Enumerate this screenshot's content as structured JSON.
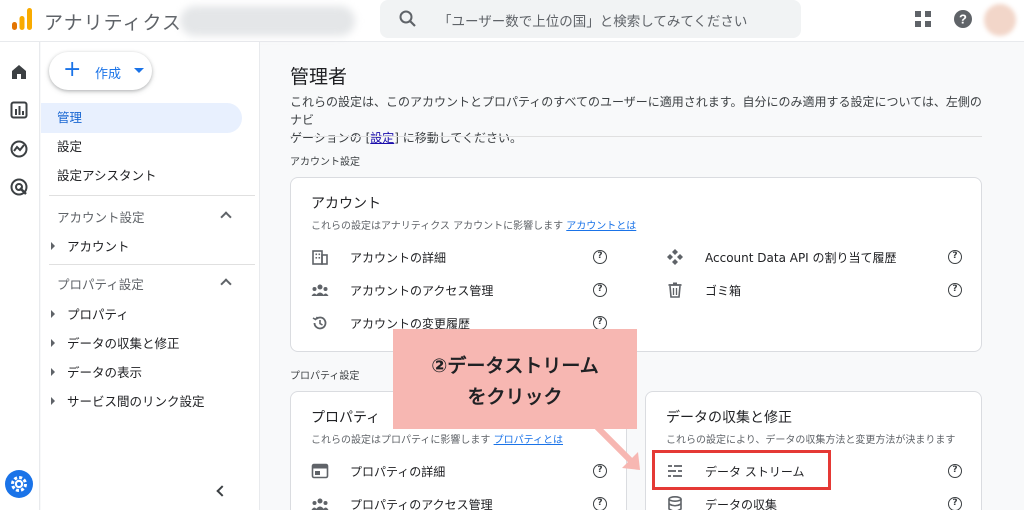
{
  "header": {
    "app_title": "アナリティクス",
    "search_placeholder": "「ユーザー数で上位の国」と検索してみてください",
    "icons": [
      "analytics-logo-icon",
      "search-icon",
      "apps-grid-icon",
      "help-icon"
    ]
  },
  "rail": {
    "icons": [
      "home-icon",
      "reports-icon",
      "explore-icon",
      "advertising-icon",
      "settings-gear-icon"
    ]
  },
  "sidebar": {
    "create_label": "作成",
    "items": [
      {
        "label": "管理",
        "active": true
      },
      {
        "label": "設定",
        "active": false
      },
      {
        "label": "設定アシスタント",
        "active": false
      }
    ],
    "account_section": {
      "heading": "アカウント設定",
      "items": [
        "アカウント"
      ]
    },
    "property_section": {
      "heading": "プロパティ設定",
      "items": [
        "プロパティ",
        "データの収集と修正",
        "データの表示",
        "サービス間のリンク設定"
      ]
    }
  },
  "main": {
    "title": "管理者",
    "description_part1": "これらの設定は、このアカウントとプロパティのすべてのユーザーに適用されます。自分にのみ適用する設定については、左側のナビ",
    "description_part2_pre": "ゲーションの [",
    "description_link": "設定",
    "description_part2_post": "] に移動してください。",
    "account_settings_label": "アカウント設定",
    "property_settings_label": "プロパティ設定",
    "account_card": {
      "title": "アカウント",
      "desc": "これらの設定はアナリティクス アカウントに影響します",
      "desc_link": "アカウントとは",
      "left_rows": [
        "アカウントの詳細",
        "アカウントのアクセス管理",
        "アカウントの変更履歴"
      ],
      "right_rows": [
        "Account Data API の割り当て履歴",
        "ゴミ箱"
      ]
    },
    "property_card": {
      "title": "プロパティ",
      "desc": "これらの設定はプロパティに影響します",
      "desc_link": "プロパティとは",
      "rows": [
        "プロパティの詳細",
        "プロパティのアクセス管理"
      ]
    },
    "data_card": {
      "title": "データの収集と修正",
      "desc": "これらの設定により、データの収集方法と変更方法が決まります",
      "rows": [
        "データ ストリーム",
        "データの収集"
      ]
    }
  },
  "annotation": {
    "line1": "②データストリーム",
    "line2": "をクリック",
    "bg_color": "#f7b7b2",
    "highlight_color": "#e53935"
  }
}
